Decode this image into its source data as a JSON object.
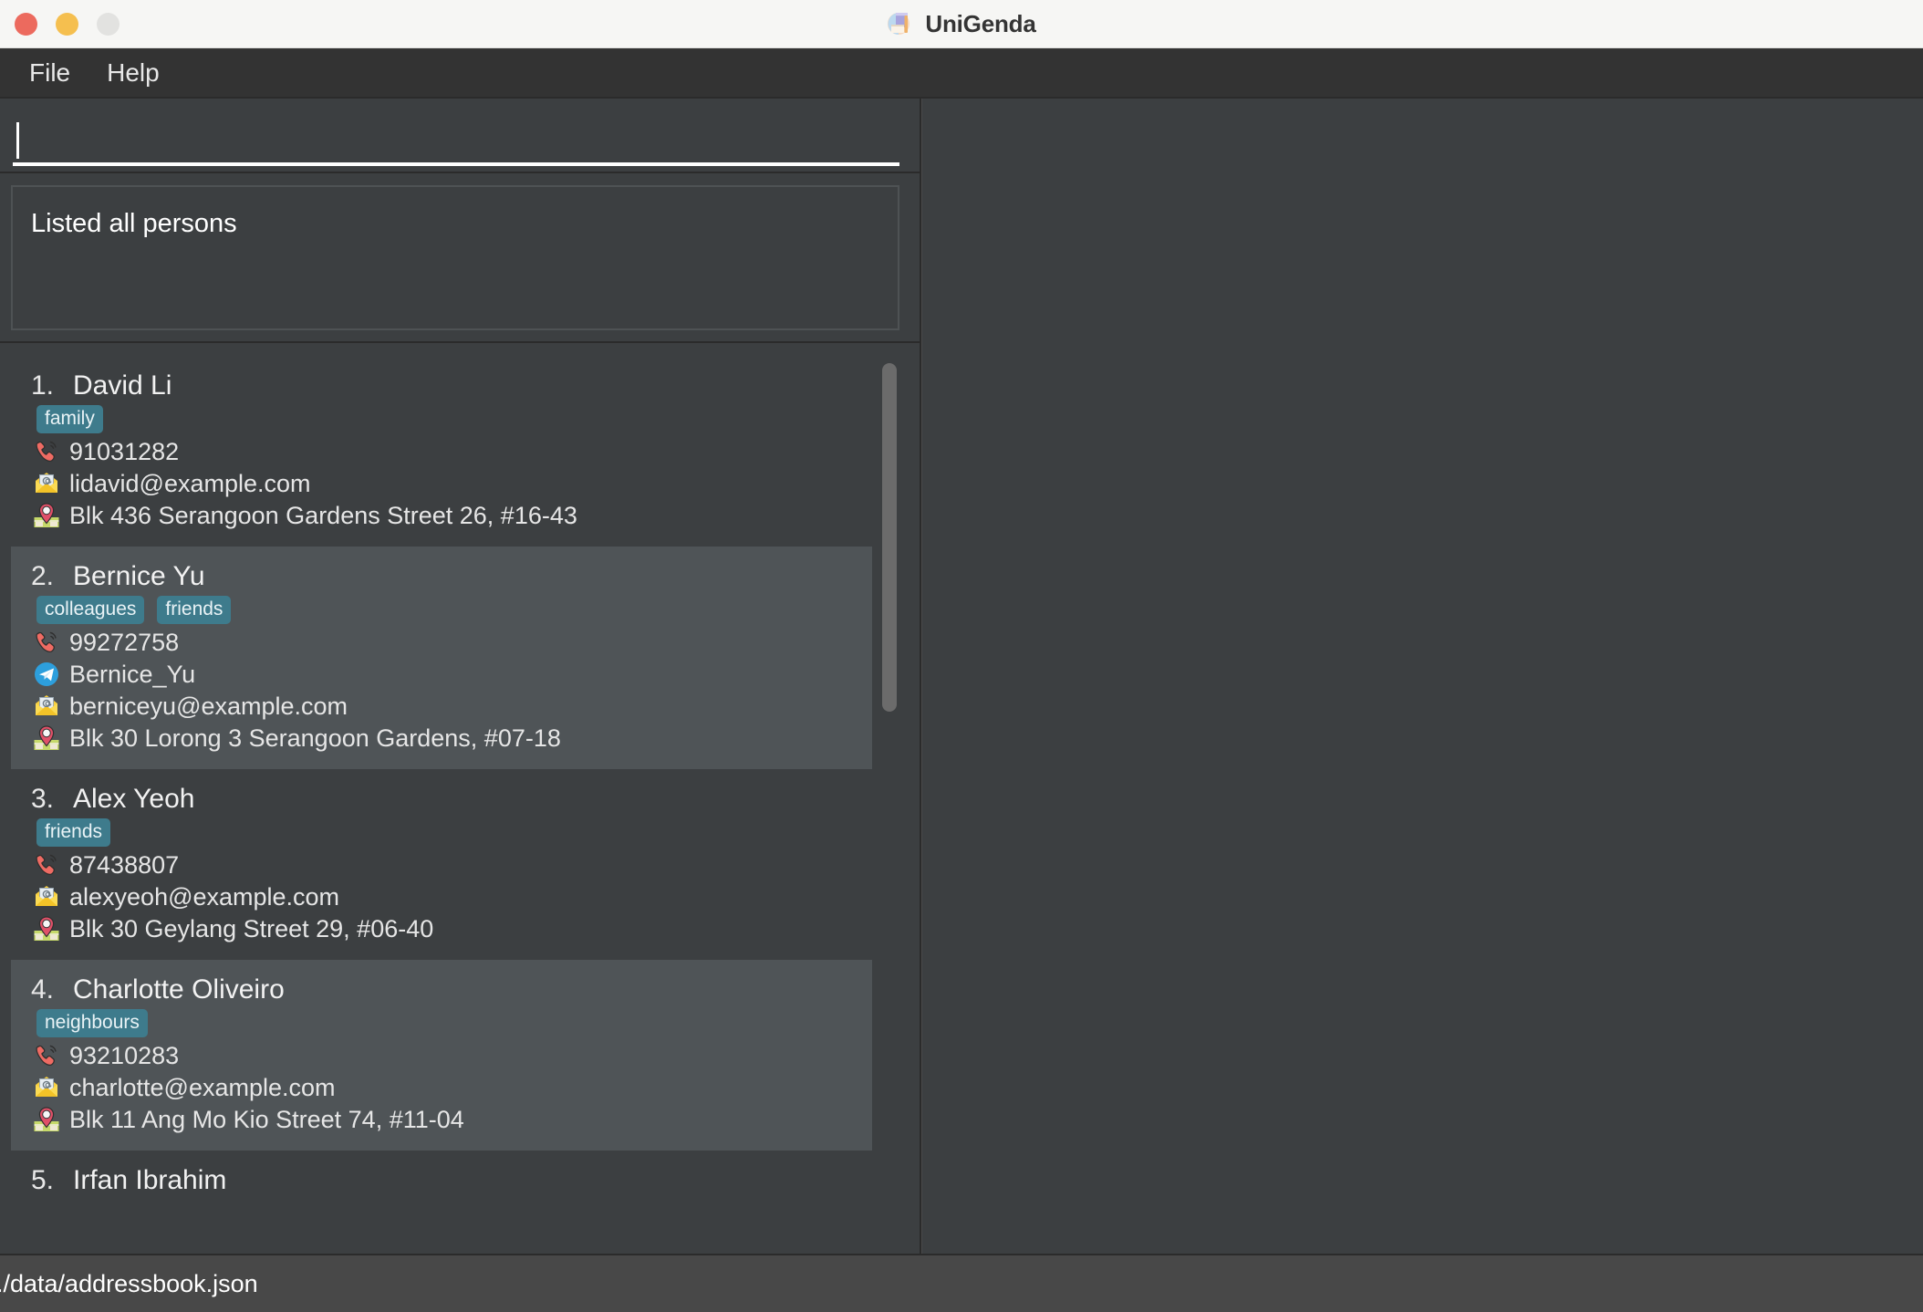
{
  "window": {
    "title": "UniGenda",
    "icon": "address-book-icon",
    "traffic_lights": [
      {
        "name": "close",
        "color": "#ec6a5e"
      },
      {
        "name": "minimize",
        "color": "#f5bf4f"
      },
      {
        "name": "zoom",
        "color": "#e2e2e0"
      }
    ]
  },
  "menu": {
    "items": [
      {
        "label": "File"
      },
      {
        "label": "Help"
      }
    ]
  },
  "command_box": {
    "value": "",
    "placeholder": ""
  },
  "result_display": {
    "text": "Listed all persons"
  },
  "persons": [
    {
      "index": "1.",
      "name": "David Li",
      "tags": [
        "family"
      ],
      "details": [
        {
          "icon": "phone-icon",
          "text": "91031282"
        },
        {
          "icon": "email-icon",
          "text": "lidavid@example.com"
        },
        {
          "icon": "address-pin-icon",
          "text": "Blk 436 Serangoon Gardens Street 26, #16-43"
        }
      ]
    },
    {
      "index": "2.",
      "name": "Bernice Yu",
      "tags": [
        "colleagues",
        "friends"
      ],
      "details": [
        {
          "icon": "phone-icon",
          "text": "99272758"
        },
        {
          "icon": "telegram-icon",
          "text": "Bernice_Yu"
        },
        {
          "icon": "email-icon",
          "text": "berniceyu@example.com"
        },
        {
          "icon": "address-pin-icon",
          "text": "Blk 30 Lorong 3 Serangoon Gardens, #07-18"
        }
      ]
    },
    {
      "index": "3.",
      "name": "Alex Yeoh",
      "tags": [
        "friends"
      ],
      "details": [
        {
          "icon": "phone-icon",
          "text": "87438807"
        },
        {
          "icon": "email-icon",
          "text": "alexyeoh@example.com"
        },
        {
          "icon": "address-pin-icon",
          "text": "Blk 30 Geylang Street 29, #06-40"
        }
      ]
    },
    {
      "index": "4.",
      "name": "Charlotte Oliveiro",
      "tags": [
        "neighbours"
      ],
      "details": [
        {
          "icon": "phone-icon",
          "text": "93210283"
        },
        {
          "icon": "email-icon",
          "text": "charlotte@example.com"
        },
        {
          "icon": "address-pin-icon",
          "text": "Blk 11 Ang Mo Kio Street 74, #11-04"
        }
      ]
    },
    {
      "index": "5.",
      "name": "Irfan Ibrahim",
      "tags": [],
      "details": []
    }
  ],
  "status_bar": {
    "file_path": "./data/addressbook.json"
  },
  "colors": {
    "window_chrome": "#f6f6f4",
    "menu_bar": "#333333",
    "panel_background": "#3c3f41",
    "row_alt_background": "#4f5457",
    "tag_background": "#3e7b8c",
    "status_bar": "#484848",
    "text_primary": "#e8e8e8",
    "scrollbar_thumb": "#6b6b6b"
  }
}
